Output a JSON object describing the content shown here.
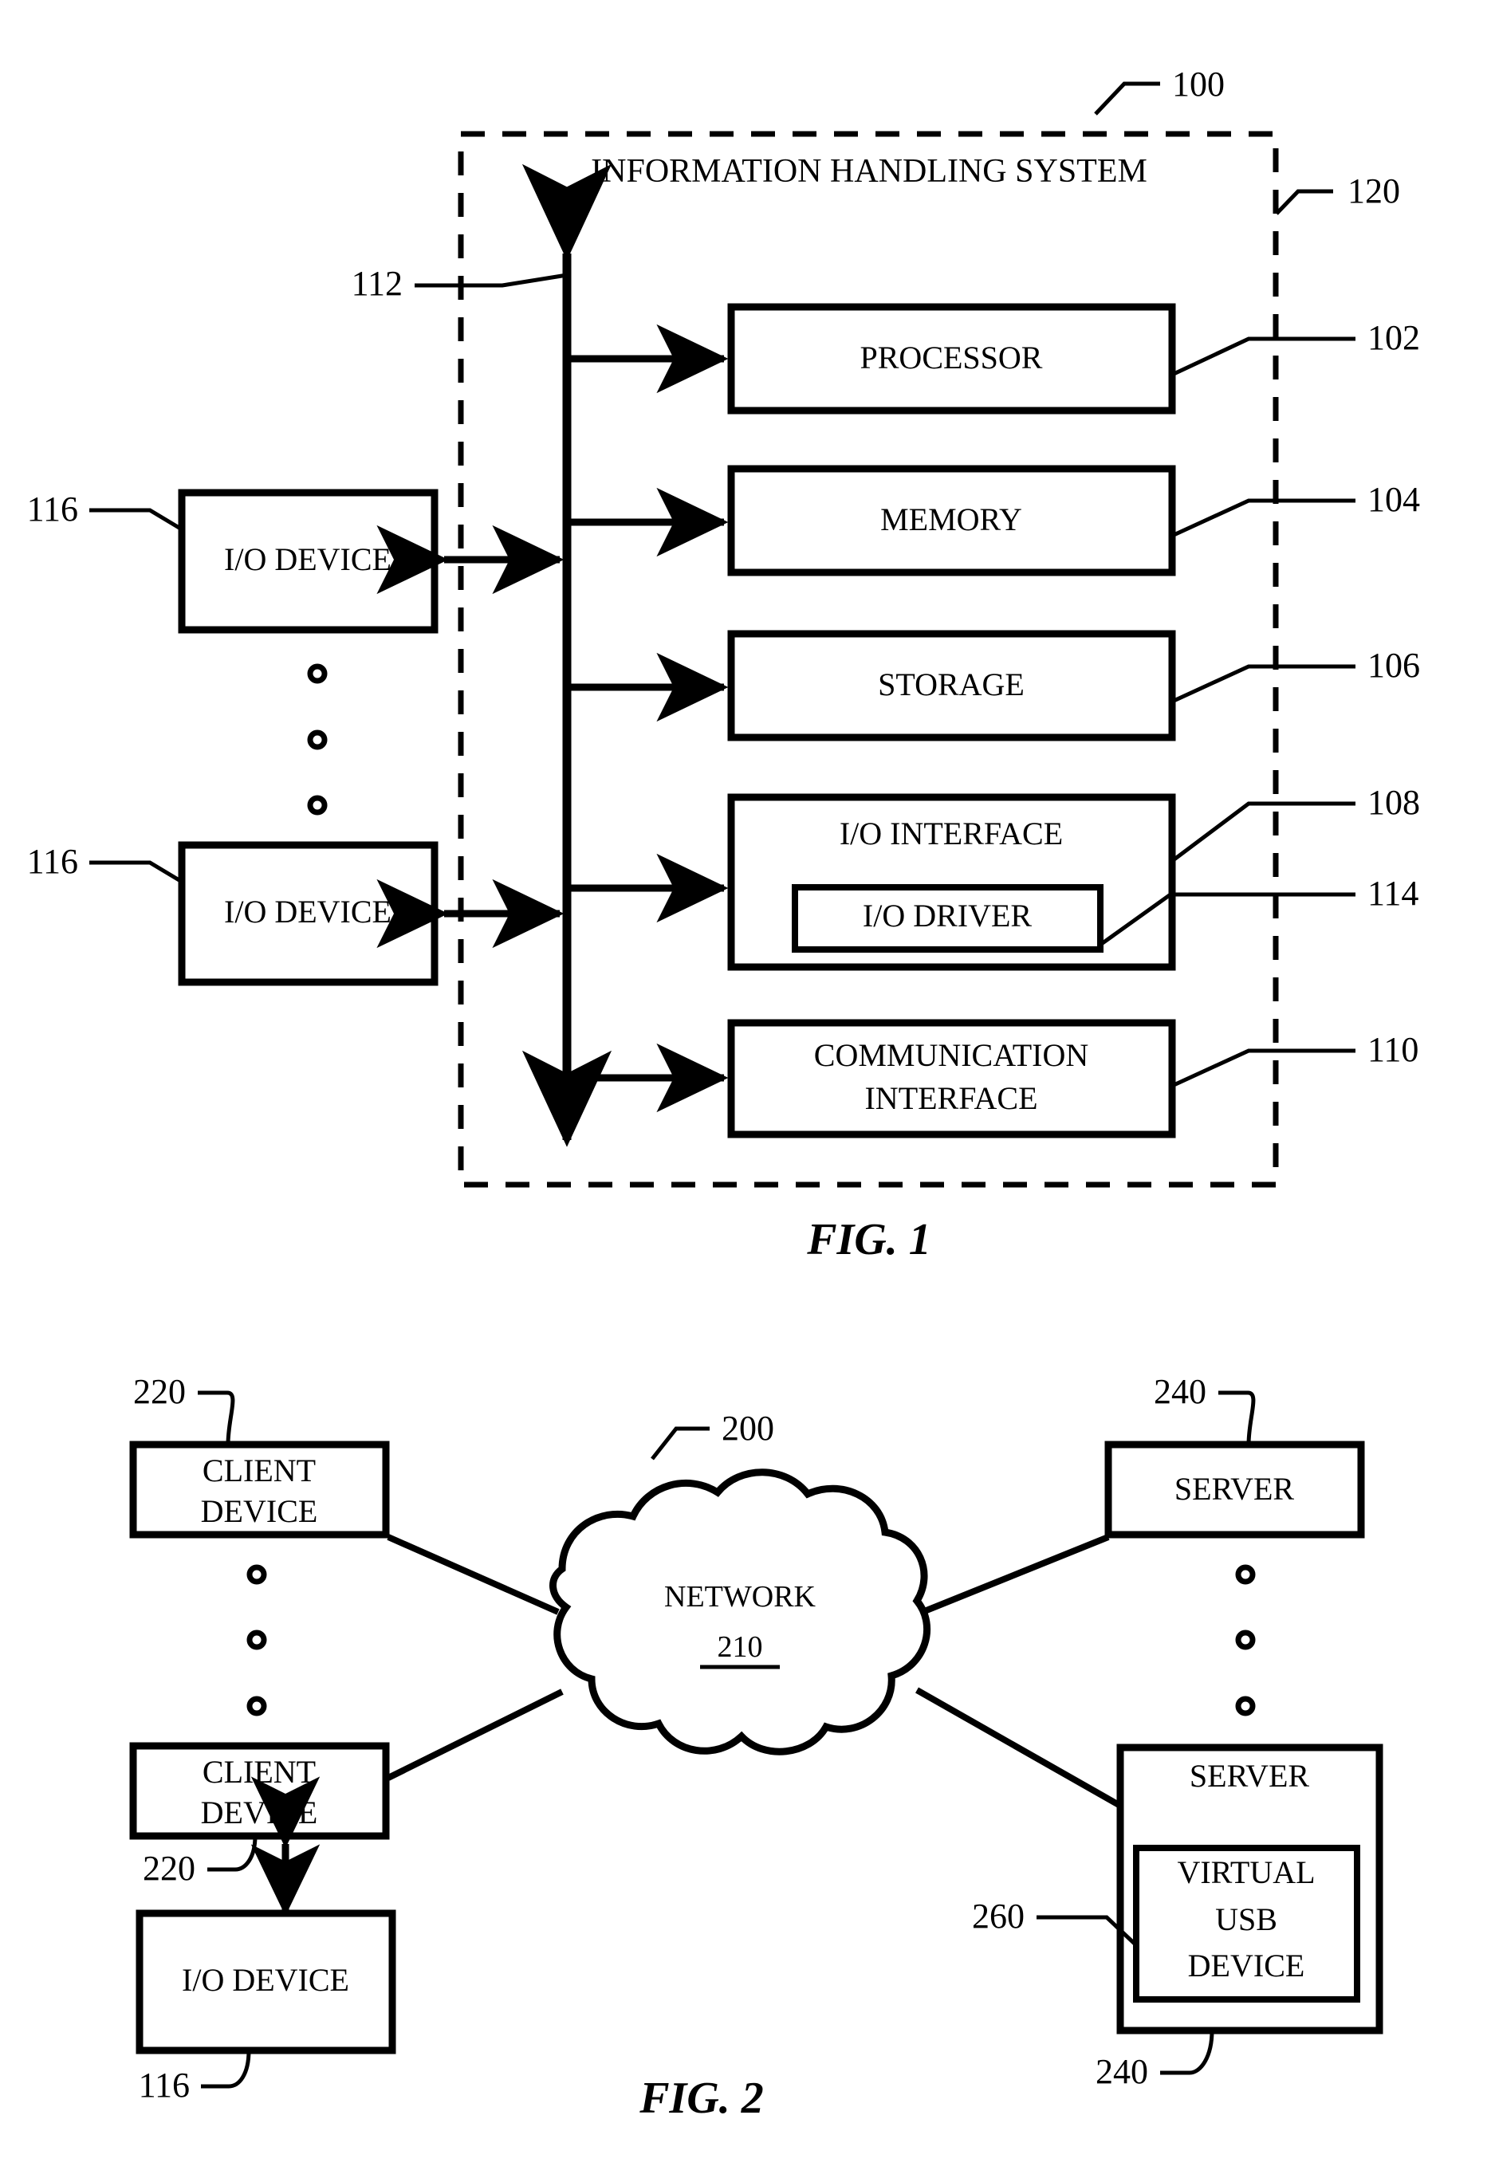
{
  "figure1": {
    "caption": "FIG. 1",
    "system_title": "INFORMATION HANDLING SYSTEM",
    "system_ref": "100",
    "boundary_ref": "120",
    "bus_ref": "112",
    "blocks": [
      {
        "label": "PROCESSOR",
        "ref": "102"
      },
      {
        "label": "MEMORY",
        "ref": "104"
      },
      {
        "label": "STORAGE",
        "ref": "106"
      },
      {
        "label": "I/O INTERFACE",
        "ref": "108"
      },
      {
        "label": "COMMUNICATION INTERFACE",
        "line1": "COMMUNICATION",
        "line2": "INTERFACE",
        "ref": "110"
      }
    ],
    "io_driver": {
      "label": "I/O DRIVER",
      "ref": "114"
    },
    "io_devices": [
      {
        "label": "I/O DEVICE",
        "ref": "116"
      },
      {
        "label": "I/O DEVICE",
        "ref": "116"
      }
    ],
    "ellipsis_count": 3
  },
  "figure2": {
    "caption": "FIG. 2",
    "system_ref": "200",
    "network": {
      "label": "NETWORK",
      "ref": "210"
    },
    "client_devices": [
      {
        "line1": "CLIENT",
        "line2": "DEVICE",
        "ref": "220"
      },
      {
        "line1": "CLIENT",
        "line2": "DEVICE",
        "ref": "220"
      }
    ],
    "servers": [
      {
        "label": "SERVER",
        "ref": "240"
      },
      {
        "label": "SERVER",
        "ref": "240"
      }
    ],
    "virtual_usb_device": {
      "line1": "VIRTUAL",
      "line2": "USB",
      "line3": "DEVICE",
      "ref": "260"
    },
    "io_device": {
      "label": "I/O DEVICE",
      "ref": "116"
    },
    "ellipsis_count_left": 3,
    "ellipsis_count_right": 3
  },
  "style": {
    "ink": "#000000",
    "paper": "#ffffff"
  }
}
